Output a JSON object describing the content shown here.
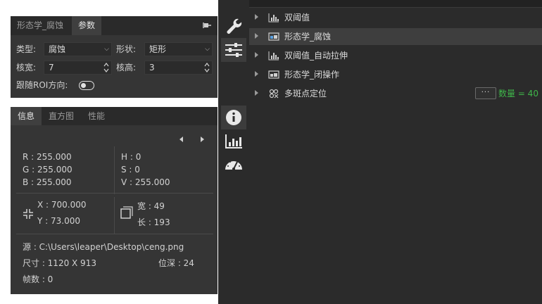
{
  "param_panel": {
    "tabs": [
      {
        "label": "形态学_腐蚀",
        "active": false
      },
      {
        "label": "参数",
        "active": true
      }
    ],
    "fields": {
      "type_label": "类型:",
      "type_value": "腐蚀",
      "shape_label": "形状:",
      "shape_value": "矩形",
      "kernel_w_label": "核宽:",
      "kernel_w_value": "7",
      "kernel_h_label": "核高:",
      "kernel_h_value": "3",
      "follow_roi_label": "跟随ROI方向:"
    },
    "pin_icon": "pin-icon"
  },
  "info_panel": {
    "tabs": [
      {
        "label": "信息",
        "active": true
      },
      {
        "label": "直方图",
        "active": false
      },
      {
        "label": "性能",
        "active": false
      }
    ],
    "rgb": [
      "R : 255.000",
      "G : 255.000",
      "B : 255.000"
    ],
    "hsv": [
      "H : 0",
      "S : 0",
      "V : 255.000"
    ],
    "coords": [
      "X : 700.000",
      "Y : 73.000"
    ],
    "size": [
      "宽 : 49",
      "长 : 193"
    ],
    "source": "源   : C:\\Users\\leaper\\Desktop\\ceng.png",
    "dimensions": "尺寸 : 1120 X 913",
    "bit_depth": "位深 : 24",
    "frames": "帧数 : 0"
  },
  "toolbar": {
    "tools": [
      "wrench-icon",
      "sliders-icon",
      "info-icon",
      "bar-chart-icon",
      "gauge-icon"
    ],
    "active": [
      "sliders-icon",
      "info-icon"
    ]
  },
  "tree": {
    "items": [
      {
        "label": "双阈值",
        "icon": "histogram-icon",
        "selected": false
      },
      {
        "label": "形态学_腐蚀",
        "icon": "image-icon",
        "selected": true
      },
      {
        "label": "双阈值_自动拉伸",
        "icon": "histogram-icon",
        "selected": false
      },
      {
        "label": "形态学_闭操作",
        "icon": "image-icon",
        "selected": false
      },
      {
        "label": "多斑点定位",
        "icon": "blob-icon",
        "selected": false
      }
    ],
    "more_label": "···",
    "count_label": "数量 = 40"
  },
  "colors": {
    "panel_bg": "#353535",
    "dark_bg": "#2b2b2b",
    "accent_green": "#3fb54a",
    "text": "#d2d2d2"
  }
}
